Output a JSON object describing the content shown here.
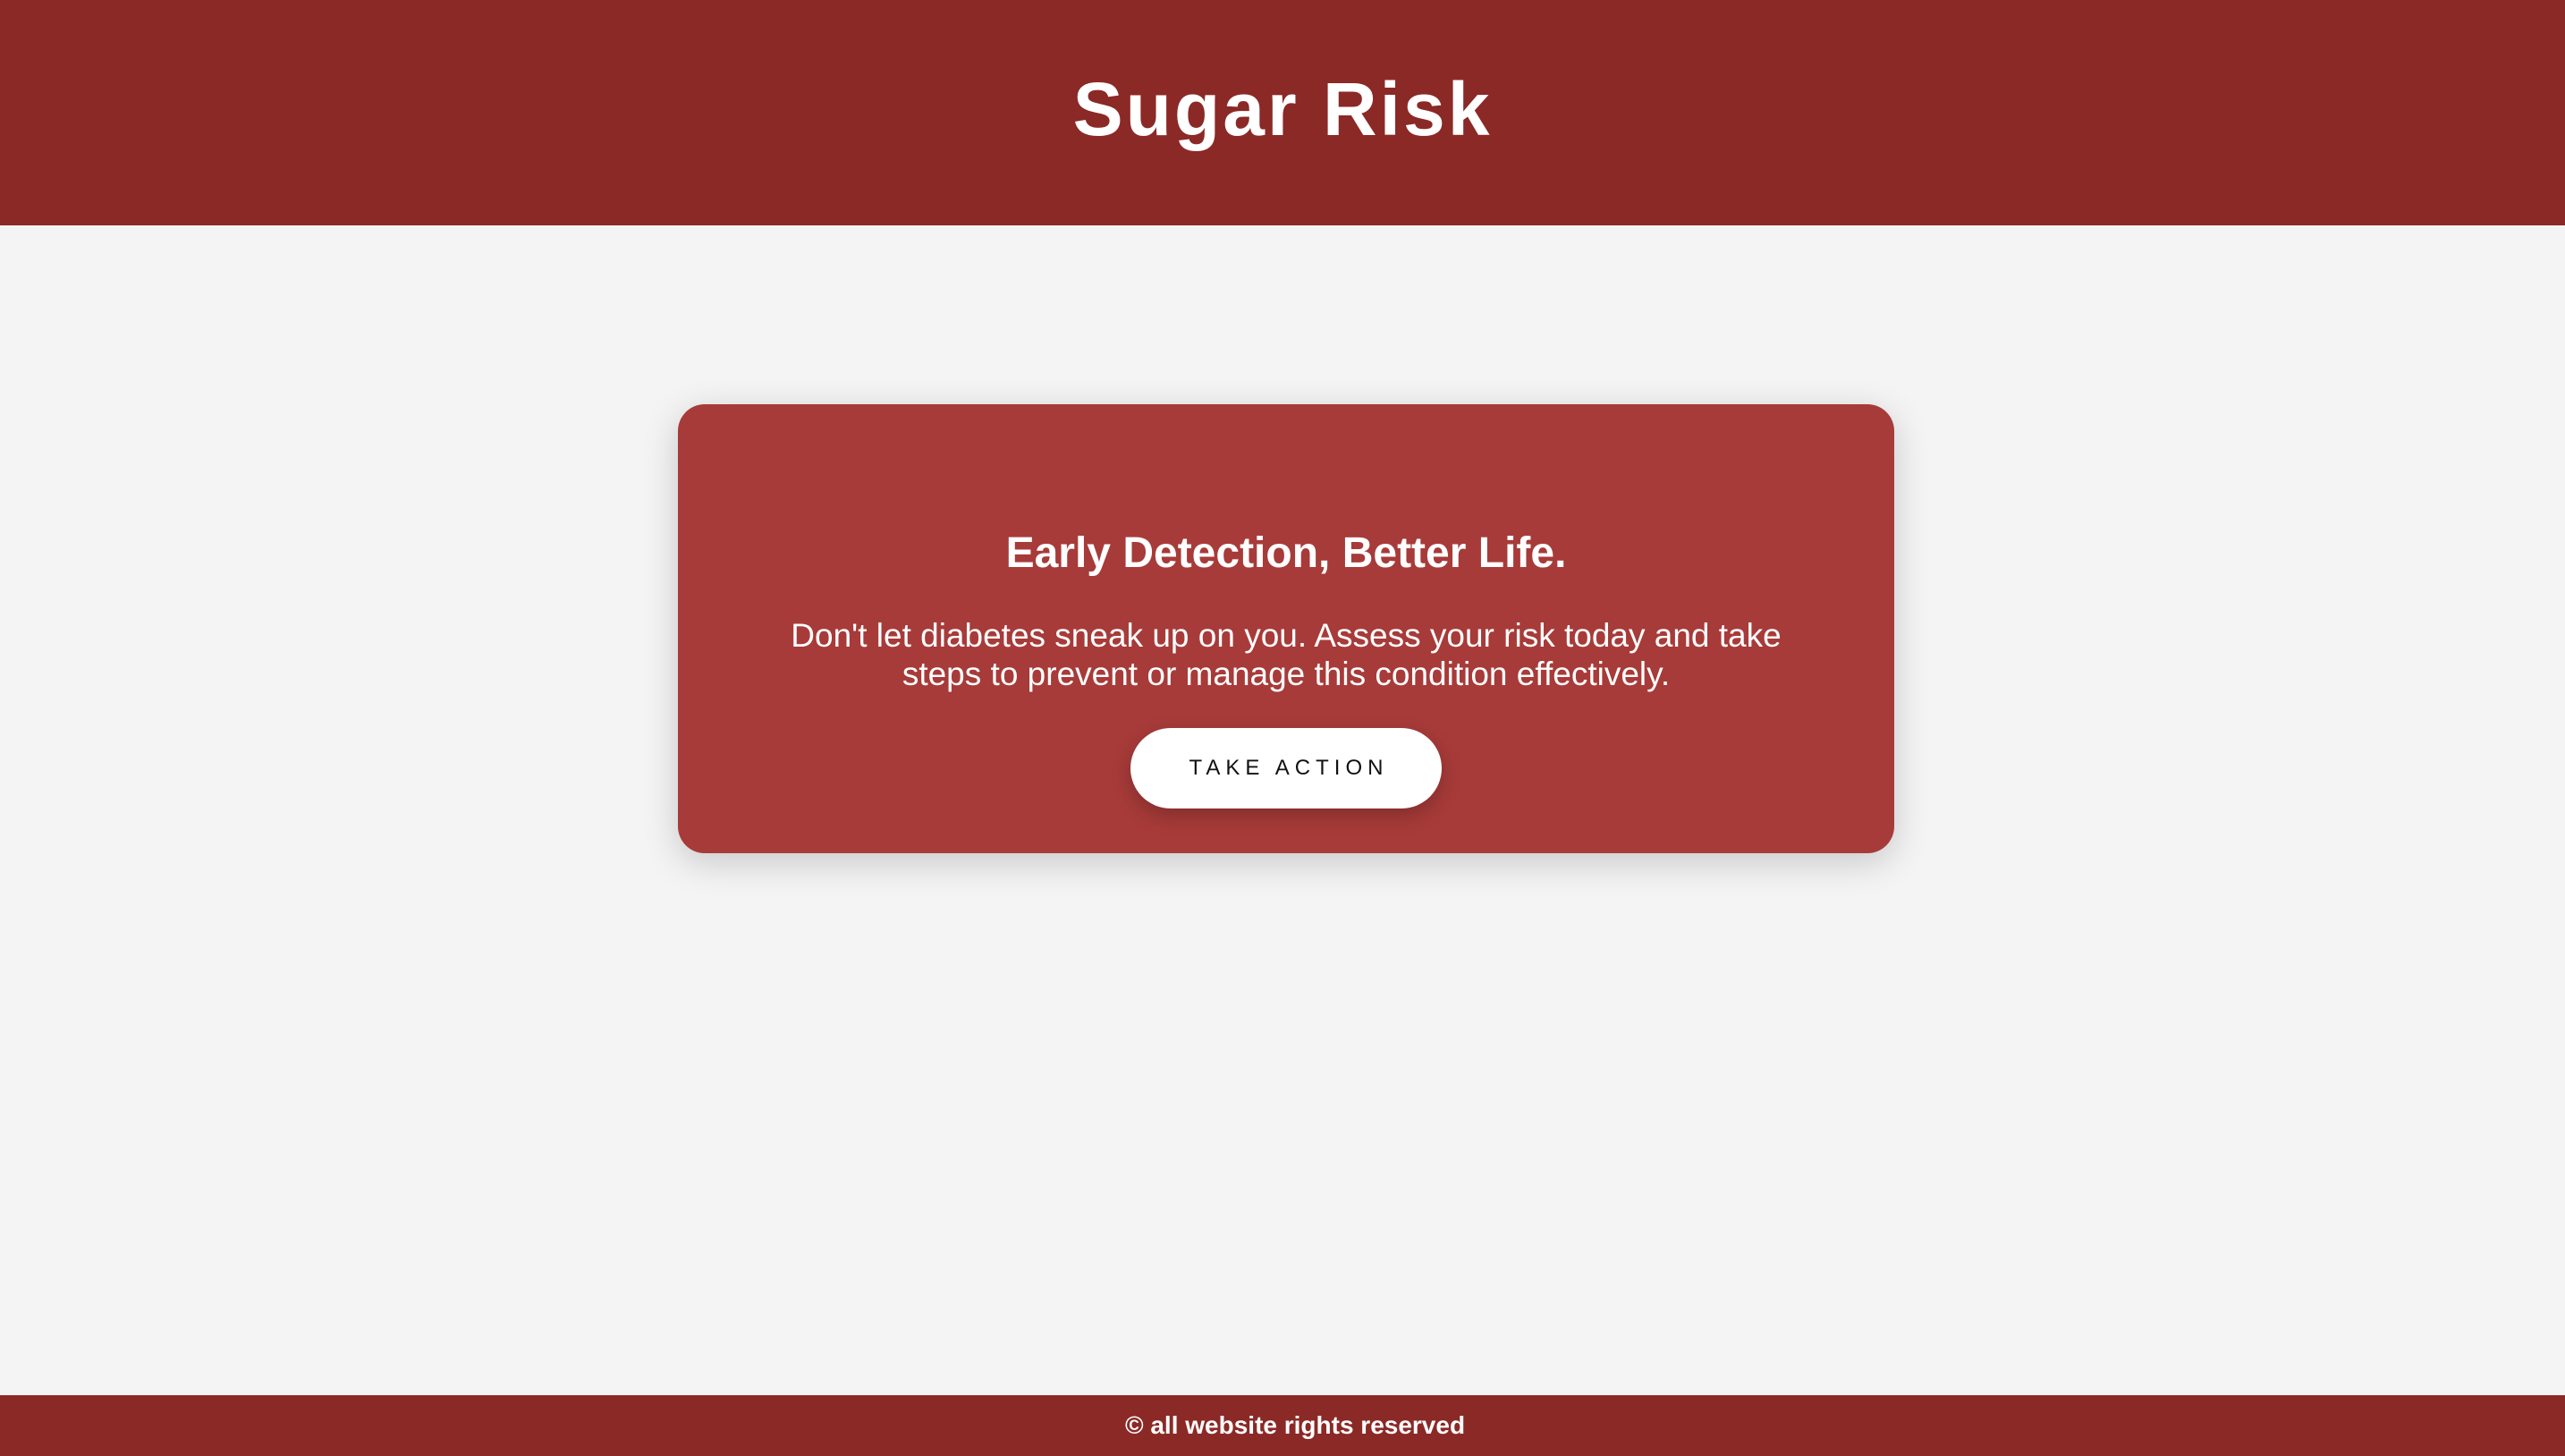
{
  "header": {
    "title": "Sugar Risk"
  },
  "hero": {
    "heading": "Early Detection, Better Life.",
    "text": "Don't let diabetes sneak up on you. Assess your risk today and take steps to prevent or manage this condition effectively.",
    "button_label": "Take Action"
  },
  "footer": {
    "text": "© all website rights reserved"
  },
  "colors": {
    "header_bg": "#8b2926",
    "card_bg": "#a73b39",
    "page_bg": "#f4f4f4",
    "button_bg": "#ffffff"
  }
}
